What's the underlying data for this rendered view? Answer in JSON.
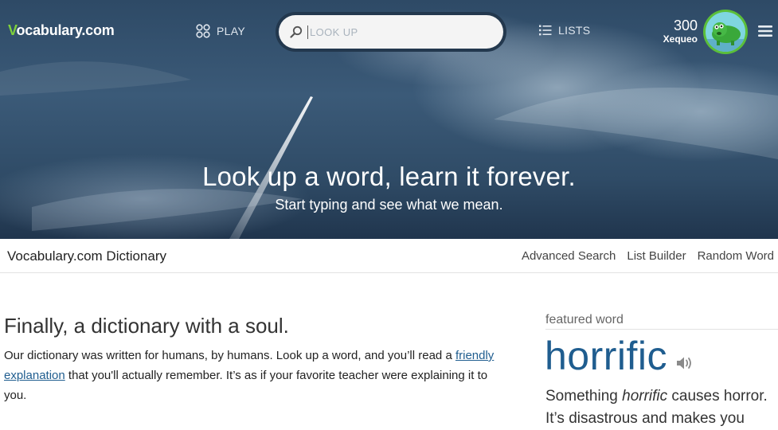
{
  "header": {
    "logo_v": "V",
    "logo_rest": "ocabulary.com",
    "play_label": "PLAY",
    "lists_label": "LISTS",
    "search_placeholder": "LOOK UP",
    "points": "300",
    "username": "Xequeo"
  },
  "hero": {
    "title": "Look up a word, learn it forever.",
    "subtitle": "Start typing and see what we mean."
  },
  "subheader": {
    "title": "Vocabulary.com Dictionary",
    "links": [
      "Advanced Search",
      "List Builder",
      "Random Word"
    ]
  },
  "intro": {
    "heading": "Finally, a dictionary with a soul.",
    "text_before": "Our dictionary was written for humans, by humans. Look up a word, and you’ll read a ",
    "link_text": "friendly explanation",
    "text_after": " that you'll actually remember. It’s as if your favorite teacher were explaining it to you."
  },
  "featured": {
    "label": "featured word",
    "word": "horrific",
    "def_before": "Something ",
    "def_em": "horrific",
    "def_after": " causes horror. It’s disastrous and makes you"
  },
  "colors": {
    "brand_green": "#7fd13b",
    "link_blue": "#1f5d8f"
  },
  "icons": [
    "play-grid-icon",
    "search-icon",
    "list-icon",
    "hamburger-menu-icon",
    "speaker-icon",
    "avatar-creature"
  ]
}
